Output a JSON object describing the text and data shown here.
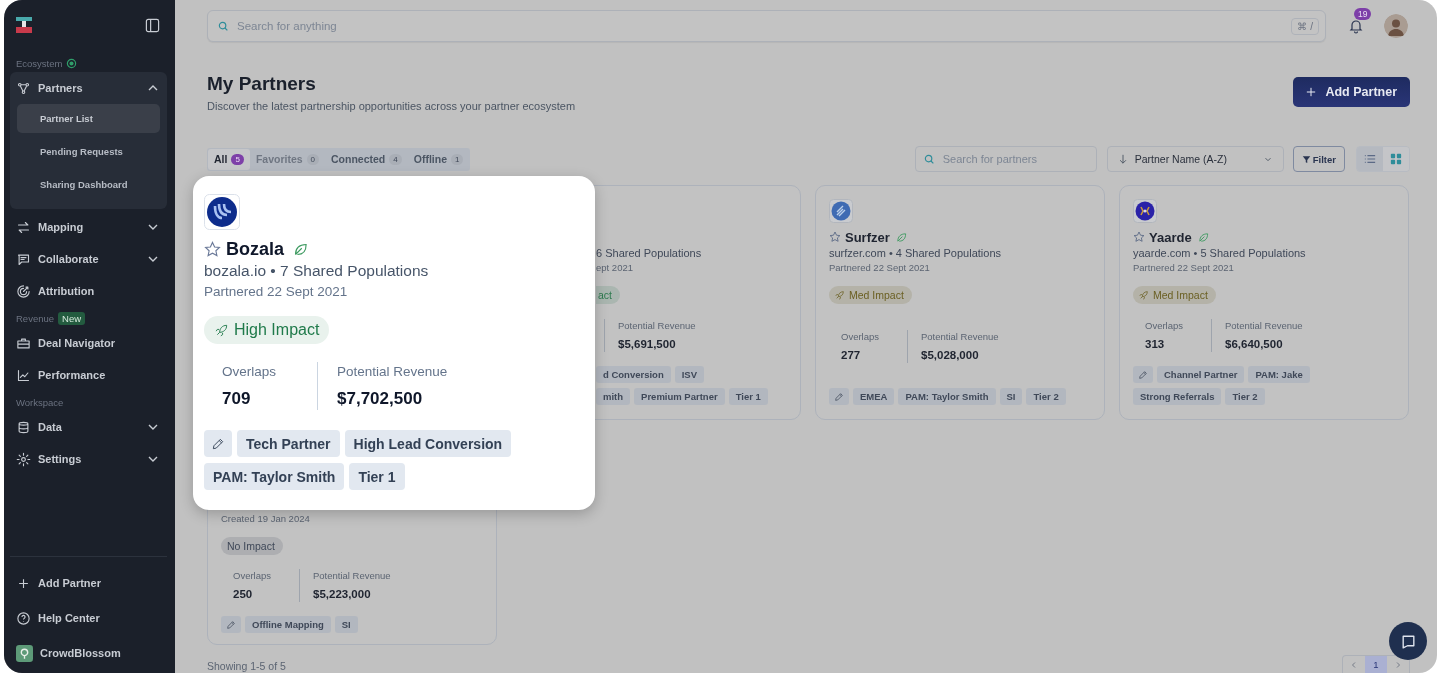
{
  "sidebar": {
    "nav": [
      {
        "kind": "heading",
        "label": "Ecosystem"
      },
      {
        "kind": "link",
        "label": "Partners",
        "expanded": true,
        "children": [
          {
            "label": "Partner List",
            "selected": true
          },
          {
            "label": "Pending Requests",
            "selected": false
          },
          {
            "label": "Sharing Dashboard",
            "selected": false
          }
        ]
      },
      {
        "kind": "link",
        "label": "Mapping",
        "expanded": false
      },
      {
        "kind": "link",
        "label": "Collaborate",
        "expanded": false
      },
      {
        "kind": "link",
        "label": "Attribution"
      },
      {
        "kind": "heading",
        "label": "Revenue",
        "badge": "New"
      },
      {
        "kind": "link",
        "label": "Deal Navigator"
      },
      {
        "kind": "link",
        "label": "Performance"
      },
      {
        "kind": "heading",
        "label": "Workspace"
      },
      {
        "kind": "link",
        "label": "Data",
        "expanded": false
      },
      {
        "kind": "link",
        "label": "Settings",
        "expanded": false
      }
    ],
    "footer": [
      "Add Partner",
      "Help Center"
    ],
    "workspace": "CrowdBlossom"
  },
  "topbar": {
    "search_placeholder": "Search for anything",
    "shortcut": "⌘ /",
    "notification_count": "19"
  },
  "header": {
    "title": "My Partners",
    "subtitle": "Discover the latest partnership opportunities across your partner ecosystem",
    "add_button": "Add Partner"
  },
  "tabs": [
    {
      "label": "All",
      "count": "5",
      "selected": true,
      "disabled": false
    },
    {
      "label": "Favorites",
      "count": "0",
      "selected": false,
      "disabled": true
    },
    {
      "label": "Connected",
      "count": "4",
      "selected": false,
      "disabled": false
    },
    {
      "label": "Offline",
      "count": "1",
      "selected": false,
      "disabled": false
    }
  ],
  "toolbar": {
    "search_placeholder": "Search for partners",
    "sort": "Partner Name (A-Z)",
    "filter": "Filter",
    "views": [
      {
        "selected": false
      },
      {
        "selected": true
      }
    ]
  },
  "focused_card": {
    "name": "Bozala",
    "favorite": false,
    "verified": true,
    "meta": "bozala.io • 7 Shared Populations",
    "date": "Partnered 22 Sept 2021",
    "impact": {
      "label": "High Impact",
      "color": "#1f7a4a",
      "rocket": true
    },
    "overlaps_label": "Overlaps",
    "overlaps": "709",
    "revenue_label": "Potential Revenue",
    "revenue": "$7,702,500",
    "tag_rows": [
      [
        "Tech Partner",
        "High Lead Conversion"
      ],
      [
        "PAM: Taylor Smith",
        "Tier 1"
      ]
    ]
  },
  "cards": [
    {
      "kind": "clipped_left",
      "meta": "6 Shared Populations",
      "date": "ept 2021",
      "impact": {
        "label": "act",
        "color": "#2e7a4f",
        "rocket": false
      },
      "revenue_label": "Potential Revenue",
      "revenue": "$5,691,500",
      "tag_rows": [
        [
          "d Conversion",
          "ISV"
        ],
        [
          "mith",
          "Premium Partner",
          "Tier 1"
        ]
      ]
    },
    {
      "kind": "full",
      "name": "Surfzer",
      "favorite": false,
      "verified": true,
      "meta": "surfzer.com • 4 Shared Populations",
      "date": "Partnered 22 Sept 2021",
      "impact": {
        "label": "Med Impact",
        "color": "#6a5f22",
        "rocket": true
      },
      "overlaps_label": "Overlaps",
      "overlaps": "277",
      "revenue_label": "Potential Revenue",
      "revenue": "$5,028,000",
      "tag_rows": [
        [
          "EMEA",
          "PAM: Taylor Smith",
          "SI",
          "Tier 2"
        ]
      ]
    },
    {
      "kind": "full",
      "name": "Yaarde",
      "favorite": false,
      "verified": true,
      "meta": "yaarde.com • 5 Shared Populations",
      "date": "Partnered 22 Sept 2021",
      "impact": {
        "label": "Med Impact",
        "color": "#6a5f22",
        "rocket": true
      },
      "overlaps_label": "Overlaps",
      "overlaps": "313",
      "revenue_label": "Potential Revenue",
      "revenue": "$6,640,500",
      "tag_rows": [
        [
          "Channel Partner",
          "PAM: Jake"
        ],
        [
          "Strong Referrals",
          "Tier 2"
        ]
      ]
    },
    {
      "kind": "clipped_top",
      "date": "Created 19 Jan 2024",
      "impact": {
        "label": "No Impact",
        "color": "#3f4858",
        "rocket": false
      },
      "overlaps_label": "Overlaps",
      "overlaps": "250",
      "revenue_label": "Potential Revenue",
      "revenue": "$5,223,000",
      "tag_rows": [
        [
          "Offline Mapping",
          "SI"
        ]
      ]
    }
  ],
  "footer": {
    "showing": "Showing 1-5 of 5",
    "pages": [
      {
        "label": "1",
        "selected": true
      }
    ]
  }
}
